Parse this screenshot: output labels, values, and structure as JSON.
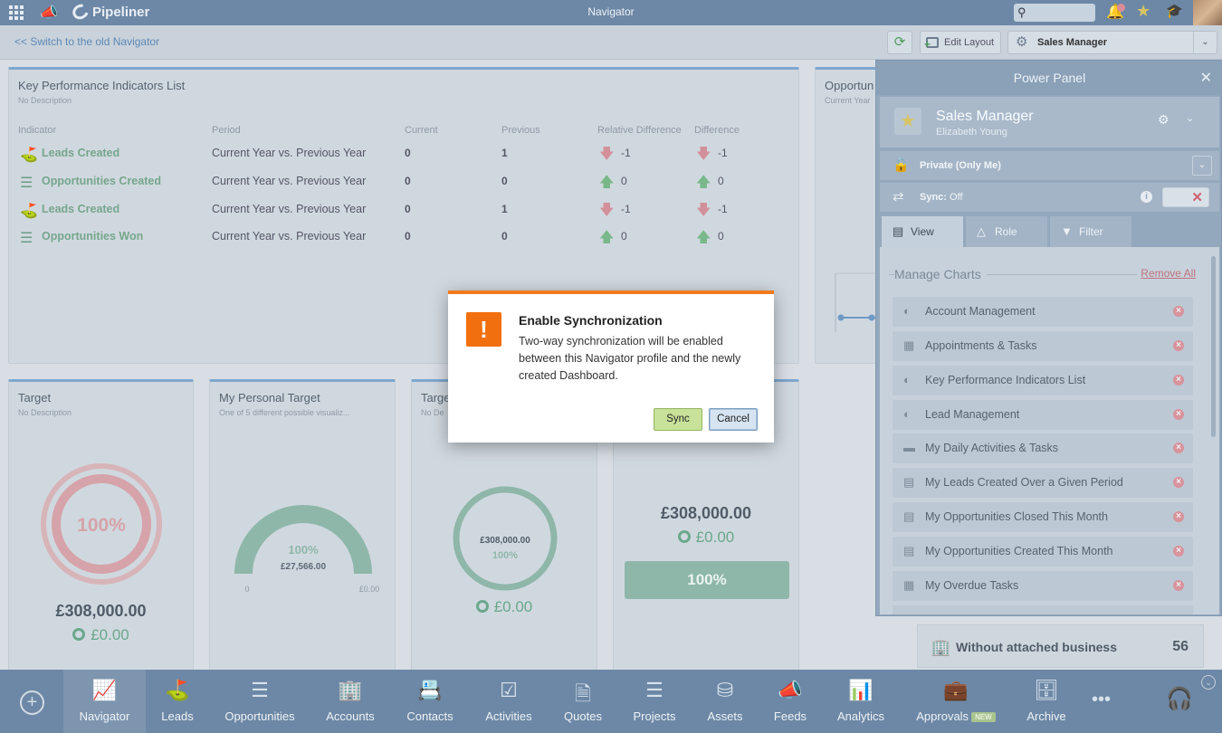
{
  "topbar": {
    "app_name": "Pipeliner",
    "title": "Navigator",
    "search_placeholder": ""
  },
  "subbar": {
    "old_navigator_link": "<< Switch to the old Navigator",
    "edit_layout_label": "Edit Layout",
    "profile_label": "Sales Manager"
  },
  "kpi_card": {
    "title": "Key Performance Indicators List",
    "description": "No Description",
    "headers": [
      "Indicator",
      "Period",
      "Current",
      "Previous",
      "Relative Difference",
      "Difference"
    ],
    "rows": [
      {
        "indicator": "Leads Created",
        "period": "Current Year vs. Previous Year",
        "current": "0",
        "previous": "1",
        "relative": "-1",
        "difference": "-1",
        "trend": "down",
        "icon": "leads-icon"
      },
      {
        "indicator": "Opportunities Created",
        "period": "Current Year vs. Previous Year",
        "current": "0",
        "previous": "0",
        "relative": "0",
        "difference": "0",
        "trend": "up",
        "icon": "opportunities-icon"
      },
      {
        "indicator": "Leads Created",
        "period": "Current Year vs. Previous Year",
        "current": "0",
        "previous": "1",
        "relative": "-1",
        "difference": "-1",
        "trend": "down",
        "icon": "leads-icon"
      },
      {
        "indicator": "Opportunities Won",
        "period": "Current Year vs. Previous Year",
        "current": "0",
        "previous": "0",
        "relative": "0",
        "difference": "0",
        "trend": "up",
        "icon": "opportunities-icon"
      }
    ]
  },
  "opp_card": {
    "title": "Opportun",
    "description": "Current Year"
  },
  "target_card": {
    "title": "Target",
    "description": "No Description",
    "percent": "100%",
    "percent_value": 100,
    "amount": "£308,000.00",
    "zero": "£0.00"
  },
  "personal_card": {
    "title": "My Personal Target",
    "description": "One of 5 different possible visualiz...",
    "percent": "100%",
    "percent_value": 100,
    "amount": "£27,566.00",
    "min_label": "0",
    "max_label": "£0.00"
  },
  "target3_card": {
    "title": "Targe",
    "description": "No De",
    "amount": "£308,000.00",
    "percent": "100%",
    "percent_value": 100,
    "zero": "£0.00"
  },
  "card4": {
    "amount": "£308,000.00",
    "zero": "£0.00",
    "percent": "100%",
    "percent_value": 100
  },
  "without_business": {
    "label": "Without attached business",
    "count": "56"
  },
  "power_panel": {
    "title": "Power Panel",
    "profile_title": "Sales Manager",
    "profile_user": "Elizabeth Young",
    "privacy_label": "Private (Only Me)",
    "sync_label": "Sync:",
    "sync_value": "Off",
    "tabs": [
      "View",
      "Role",
      "Filter"
    ],
    "manage_charts_title": "Manage Charts",
    "remove_all_label": "Remove All",
    "charts": [
      {
        "label": "Account Management",
        "icon": "gauge-icon"
      },
      {
        "label": "Appointments & Tasks",
        "icon": "task-list-icon"
      },
      {
        "label": "Key Performance Indicators List",
        "icon": "gauge-icon"
      },
      {
        "label": "Lead Management",
        "icon": "gauge-icon"
      },
      {
        "label": "My Daily Activities & Tasks",
        "icon": "bar-icon"
      },
      {
        "label": "My Leads Created Over a Given Period",
        "icon": "list-icon"
      },
      {
        "label": "My Opportunities Closed This Month",
        "icon": "list-icon"
      },
      {
        "label": "My Opportunities Created This Month",
        "icon": "list-icon"
      },
      {
        "label": "My Overdue Tasks",
        "icon": "task-list-icon"
      }
    ]
  },
  "modal": {
    "title": "Enable Synchronization",
    "body": "Two-way synchronization will be enabled between this Navigator profile and the newly created Dashboard.",
    "sync_button": "Sync",
    "cancel_button": "Cancel"
  },
  "bottomnav": {
    "items": [
      {
        "label": "Navigator",
        "icon": "navigator-icon"
      },
      {
        "label": "Leads",
        "icon": "leads-icon"
      },
      {
        "label": "Opportunities",
        "icon": "opportunities-icon"
      },
      {
        "label": "Accounts",
        "icon": "accounts-icon"
      },
      {
        "label": "Contacts",
        "icon": "contacts-icon"
      },
      {
        "label": "Activities",
        "icon": "activities-icon"
      },
      {
        "label": "Quotes",
        "icon": "quotes-icon"
      },
      {
        "label": "Projects",
        "icon": "projects-icon"
      },
      {
        "label": "Assets",
        "icon": "assets-icon"
      },
      {
        "label": "Feeds",
        "icon": "feeds-icon"
      },
      {
        "label": "Analytics",
        "icon": "analytics-icon"
      },
      {
        "label": "Approvals",
        "icon": "approvals-icon",
        "badge": "NEW"
      },
      {
        "label": "Archive",
        "icon": "archive-icon"
      }
    ]
  },
  "colors": {
    "accent_orange": "#f26f0f",
    "sync_green": "#c8e29a",
    "topbar_blue": "#6d88a6"
  }
}
